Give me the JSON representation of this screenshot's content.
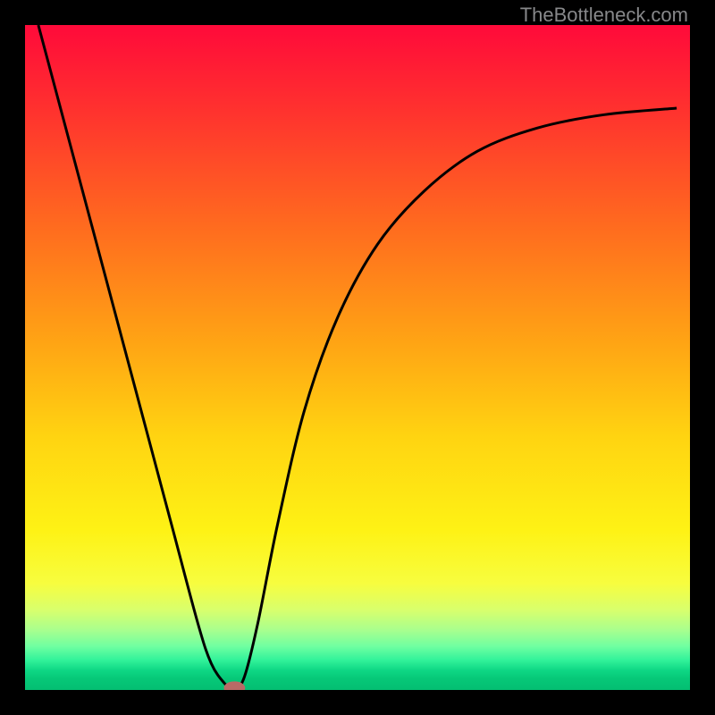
{
  "watermark": "TheBottleneck.com",
  "colors": {
    "curve_stroke": "#000000",
    "marker_fill": "#b96a66",
    "marker_stroke": "#6d3a36"
  },
  "chart_data": {
    "type": "line",
    "title": "",
    "xlabel": "",
    "ylabel": "",
    "xlim": [
      0,
      100
    ],
    "ylim": [
      0,
      100
    ],
    "note": "values estimated from pixel positions; y is percentage from bottom (0=green, 100=red)",
    "series": [
      {
        "name": "bottleneck-curve",
        "x": [
          2,
          6,
          10,
          14,
          18,
          22,
          26,
          28,
          30,
          31.5,
          33,
          35,
          38,
          42,
          47,
          53,
          60,
          68,
          77,
          87,
          98
        ],
        "values": [
          100,
          85,
          70,
          55,
          40,
          25,
          10,
          4,
          1,
          0,
          2,
          10,
          25,
          42,
          56,
          67,
          75,
          81,
          84.5,
          86.5,
          87.5
        ]
      }
    ],
    "marker": {
      "x": 31.5,
      "y": 0.3,
      "rx_pct": 1.6,
      "ry_pct": 1.0
    }
  }
}
